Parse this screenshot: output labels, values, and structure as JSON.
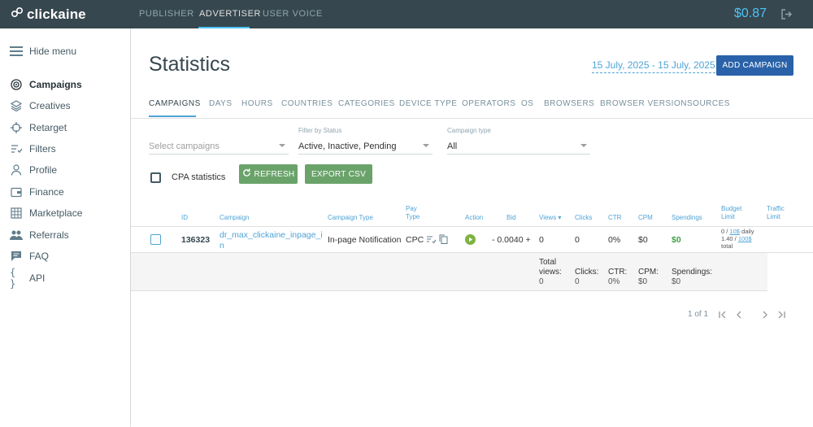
{
  "app": {
    "logo_text": "clickaine",
    "balance": "$0.87",
    "nav": [
      {
        "label": "PUBLISHER",
        "active": false
      },
      {
        "label": "ADVERTISER",
        "active": true
      },
      {
        "label": "USER VOICE",
        "active": false
      }
    ]
  },
  "sidebar": {
    "hide_menu": "Hide menu",
    "items": [
      {
        "label": "Campaigns",
        "icon": "target-icon",
        "active": true
      },
      {
        "label": "Creatives",
        "icon": "layers-icon",
        "active": false
      },
      {
        "label": "Retarget",
        "icon": "crosshair-icon",
        "active": false
      },
      {
        "label": "Filters",
        "icon": "filter-list-icon",
        "active": false
      },
      {
        "label": "Profile",
        "icon": "person-icon",
        "active": false
      },
      {
        "label": "Finance",
        "icon": "wallet-icon",
        "active": false
      },
      {
        "label": "Marketplace",
        "icon": "grid-icon",
        "active": false
      },
      {
        "label": "Referrals",
        "icon": "people-icon",
        "active": false
      },
      {
        "label": "FAQ",
        "icon": "chat-icon",
        "active": false
      },
      {
        "label": "API",
        "icon": "braces-icon",
        "active": false
      }
    ]
  },
  "main": {
    "title": "Statistics",
    "date_range": "15 July, 2025 - 15 July, 2025",
    "add_campaign": "ADD CAMPAIGN",
    "tabs": [
      {
        "label": "CAMPAIGNS",
        "active": true
      },
      {
        "label": "DAYS"
      },
      {
        "label": "HOURS"
      },
      {
        "label": "COUNTRIES"
      },
      {
        "label": "CATEGORIES"
      },
      {
        "label": "DEVICE TYPE"
      },
      {
        "label": "OPERATORS"
      },
      {
        "label": "OS"
      },
      {
        "label": "BROWSERS"
      },
      {
        "label": "BROWSER VERSION"
      },
      {
        "label": "SOURCES"
      }
    ],
    "filters": {
      "campaigns_placeholder": "Select campaigns",
      "status_label": "Filter by Status",
      "status_value": "Active, Inactive, Pending",
      "type_label": "Campaign type",
      "type_value": "All"
    },
    "cpa_label": "CPA statistics",
    "refresh": "REFRESH",
    "export": "EXPORT CSV",
    "table": {
      "headers": {
        "id": "ID",
        "campaign": "Campaign",
        "campaign_type": "Campaign Type",
        "pay_type_1": "Pay",
        "pay_type_2": "Type",
        "action": "Action",
        "bid": "Bid",
        "views": "Views ▾",
        "clicks": "Clicks",
        "ctr": "CTR",
        "cpm": "CPM",
        "spendings": "Spendings",
        "budget_1": "Budget",
        "budget_2": "Limit",
        "traffic_1": "Traffic",
        "traffic_2": "Limit"
      },
      "row": {
        "id": "136323",
        "campaign_1": "dr_max_clickaine_inpage_i",
        "campaign_2": "n",
        "campaign_type": "In-page Notification",
        "pay_type": "CPC",
        "bid": "- 0.0040 +",
        "views": "0",
        "clicks": "0",
        "ctr": "0%",
        "cpm": "$0",
        "spendings": "$0",
        "budget_daily_pre": "0 / ",
        "budget_daily_link": "10$",
        "budget_daily_post": " daily",
        "budget_total_pre": "1.40 / ",
        "budget_total_link": "100$",
        "budget_total_post": "total"
      },
      "totals": {
        "views_label_1": "Total",
        "views_label_2": "views:",
        "views": "0",
        "clicks_label": "Clicks:",
        "clicks": "0",
        "ctr_label": "CTR:",
        "ctr": "0%",
        "cpm_label": "CPM:",
        "cpm": "$0",
        "spendings_label": "Spendings:",
        "spendings": "$0"
      }
    },
    "pagination": "1 of 1"
  },
  "colors": {
    "topbar": "#37474f",
    "accent": "#4fa3d6",
    "primary_button": "#2962a8",
    "green_button": "#6aa36a",
    "spend_green": "#43a047"
  }
}
